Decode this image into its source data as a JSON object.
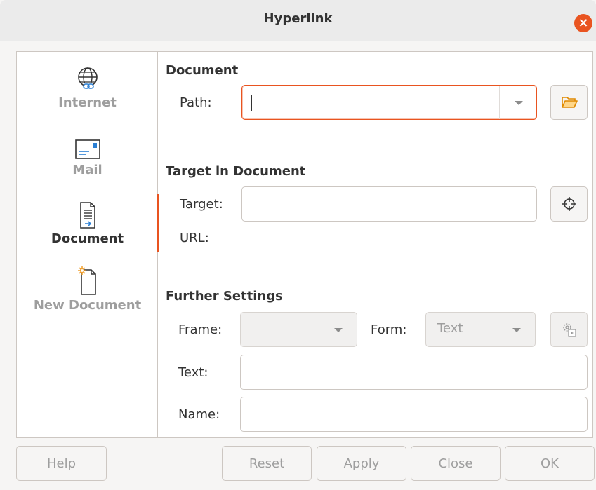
{
  "window": {
    "title": "Hyperlink"
  },
  "sidebar": {
    "items": [
      {
        "label": "Internet",
        "icon": "globe-link-icon"
      },
      {
        "label": "Mail",
        "icon": "envelope-icon"
      },
      {
        "label": "Document",
        "icon": "document-icon"
      },
      {
        "label": "New Document",
        "icon": "new-document-icon"
      }
    ],
    "active": "Document"
  },
  "document_section": {
    "title": "Document",
    "path_label": "Path:",
    "path_value": ""
  },
  "target_section": {
    "title": "Target in Document",
    "target_label": "Target:",
    "target_value": "",
    "url_label": "URL:"
  },
  "further_section": {
    "title": "Further Settings",
    "frame_label": "Frame:",
    "frame_value": "",
    "form_label": "Form:",
    "form_value": "Text",
    "text_label": "Text:",
    "text_value": "",
    "name_label": "Name:",
    "name_value": ""
  },
  "buttons": {
    "help": "Help",
    "reset": "Reset",
    "apply": "Apply",
    "close": "Close",
    "ok": "OK"
  },
  "colors": {
    "accent": "#e95420",
    "icon_blue": "#2a7fd4"
  }
}
